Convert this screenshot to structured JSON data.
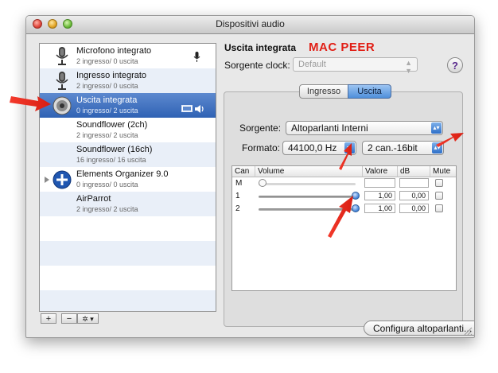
{
  "window": {
    "title": "Dispositivi audio"
  },
  "devices": [
    {
      "name": "Microfono integrato",
      "io": "2 ingresso/ 0 uscita",
      "icon": "microphone-icon",
      "badge": "microphone-badge-icon"
    },
    {
      "name": "Ingresso integrato",
      "io": "2 ingresso/ 0 uscita",
      "icon": "microphone-icon"
    },
    {
      "name": "Uscita integrata",
      "io": "0 ingresso/ 2 uscita",
      "icon": "speaker-icon",
      "selected": true,
      "badge": "speaker-badge-icon"
    },
    {
      "name": "Soundflower (2ch)",
      "io": "2 ingresso/ 2 uscita"
    },
    {
      "name": "Soundflower (16ch)",
      "io": "16 ingresso/ 16 uscita"
    },
    {
      "name": "Elements Organizer 9.0",
      "io": "0 ingresso/ 0 uscita",
      "icon": "plus-circle-icon"
    },
    {
      "name": "AirParrot",
      "io": "2 ingresso/ 2 uscita"
    }
  ],
  "list_buttons": {
    "add": "+",
    "remove": "−",
    "gear": "✲ ▾"
  },
  "detail": {
    "title": "Uscita integrata",
    "annotation": "MAC PEER",
    "clock_label": "Sorgente clock:",
    "clock_value": "Default",
    "help": "?",
    "tabs": [
      "Ingresso",
      "Uscita"
    ],
    "active_tab": "Uscita",
    "source_label": "Sorgente:",
    "source_value": "Altoparlanti Interni",
    "format_label": "Formato:",
    "format_rate": "44100,0 Hz",
    "format_bits": "2 can.-16bit",
    "configure_button": "Configura altoparlanti..."
  },
  "channels": {
    "headers": [
      "Can",
      "Volume",
      "Valore",
      "dB",
      "Mute"
    ],
    "rows": [
      {
        "ch": "M",
        "valore": "",
        "db": "",
        "level": 0.0,
        "master": true
      },
      {
        "ch": "1",
        "valore": "1,00",
        "db": "0,00",
        "level": 1.0
      },
      {
        "ch": "2",
        "valore": "1,00",
        "db": "0,00",
        "level": 1.0
      }
    ]
  },
  "colors": {
    "selection": "#2f62b4",
    "annotation": "#e11f16",
    "stripe": "#e9eff8"
  }
}
